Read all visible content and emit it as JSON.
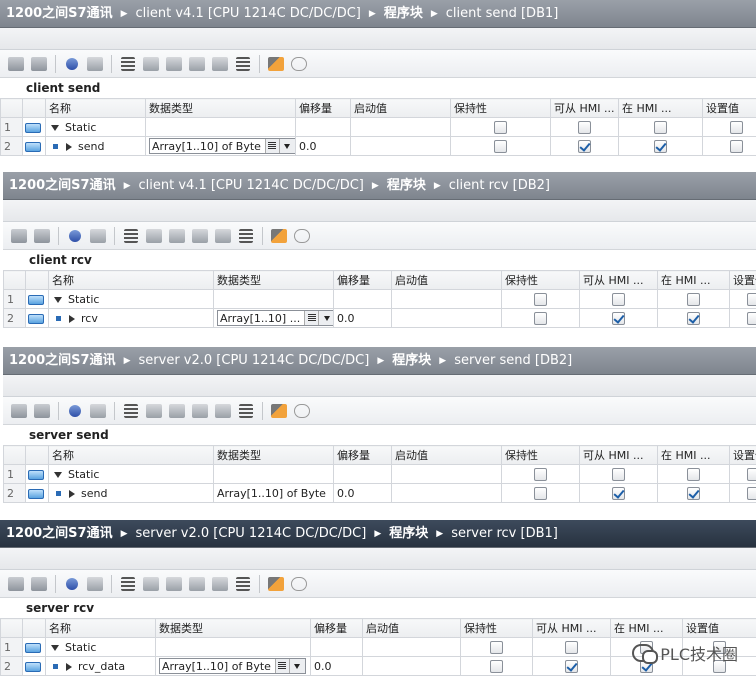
{
  "panels": [
    {
      "breadcrumb": [
        "1200之间S7通讯",
        "client v4.1 [CPU 1214C DC/DC/DC]",
        "程序块",
        "client send [DB1]"
      ],
      "block_name": "client send",
      "headers": [
        "名称",
        "数据类型",
        "偏移量",
        "启动值",
        "保持性",
        "可从 HMI ...",
        "在 HMI ...",
        "设置值"
      ],
      "rows": [
        {
          "num": "1",
          "name": "Static",
          "type": "",
          "offset": "",
          "start": "",
          "retain": false,
          "hmi_access": false,
          "hmi_visible": false,
          "setpoint": false
        },
        {
          "num": "2",
          "name": "send",
          "type": "Array[1..10] of Byte",
          "offset": "0.0",
          "start": "",
          "retain": false,
          "hmi_access": true,
          "hmi_visible": true,
          "setpoint": false
        }
      ]
    },
    {
      "breadcrumb": [
        "1200之间S7通讯",
        "client v4.1 [CPU 1214C DC/DC/DC]",
        "程序块",
        "client rcv [DB2]"
      ],
      "block_name": "client rcv",
      "headers": [
        "名称",
        "数据类型",
        "偏移量",
        "启动值",
        "保持性",
        "可从 HMI ...",
        "在 HMI ...",
        "设置值"
      ],
      "rows": [
        {
          "num": "1",
          "name": "Static",
          "type": "",
          "offset": "",
          "start": "",
          "retain": false,
          "hmi_access": false,
          "hmi_visible": false,
          "setpoint": false
        },
        {
          "num": "2",
          "name": "rcv",
          "type": "Array[1..10] ...",
          "offset": "0.0",
          "start": "",
          "retain": false,
          "hmi_access": true,
          "hmi_visible": true,
          "setpoint": false
        }
      ]
    },
    {
      "breadcrumb": [
        "1200之间S7通讯",
        "server v2.0 [CPU 1214C DC/DC/DC]",
        "程序块",
        "server send [DB2]"
      ],
      "block_name": "server send",
      "headers": [
        "名称",
        "数据类型",
        "偏移量",
        "启动值",
        "保持性",
        "可从 HMI ...",
        "在 HMI ...",
        "设置值"
      ],
      "rows": [
        {
          "num": "1",
          "name": "Static",
          "type": "",
          "offset": "",
          "start": "",
          "retain": false,
          "hmi_access": false,
          "hmi_visible": false,
          "setpoint": false
        },
        {
          "num": "2",
          "name": "send",
          "type": "Array[1..10] of Byte",
          "offset": "0.0",
          "start": "",
          "retain": false,
          "hmi_access": true,
          "hmi_visible": true,
          "setpoint": false
        }
      ]
    },
    {
      "breadcrumb": [
        "1200之间S7通讯",
        "server v2.0 [CPU 1214C DC/DC/DC]",
        "程序块",
        "server rcv [DB1]"
      ],
      "block_name": "server rcv",
      "headers": [
        "名称",
        "数据类型",
        "偏移量",
        "启动值",
        "保持性",
        "可从 HMI ...",
        "在 HMI ...",
        "设置值"
      ],
      "rows": [
        {
          "num": "1",
          "name": "Static",
          "type": "",
          "offset": "",
          "start": "",
          "retain": false,
          "hmi_access": false,
          "hmi_visible": false,
          "setpoint": false
        },
        {
          "num": "2",
          "name": "rcv_data",
          "type": "Array[1..10] of Byte",
          "offset": "0.0",
          "start": "",
          "retain": false,
          "hmi_access": true,
          "hmi_visible": true,
          "setpoint": false
        }
      ]
    }
  ],
  "toolbar_icons": [
    "insert-row-icon",
    "add-row-icon",
    "expand-icon",
    "reset-start-values-icon",
    "snapshot-icon",
    "copy-snapshot-icon",
    "copy-to-start-icon",
    "load-start-icon",
    "load-snapshot-icon",
    "list-icon",
    "monitor-icon",
    "glasses-icon"
  ],
  "watermark": {
    "text": "PLC技术圈"
  },
  "colors": {
    "titlebar": "#7e858e",
    "titlebar_active": "#27323f",
    "check_blue": "#1d5fa8",
    "db_icon": "#5aa3e0"
  }
}
